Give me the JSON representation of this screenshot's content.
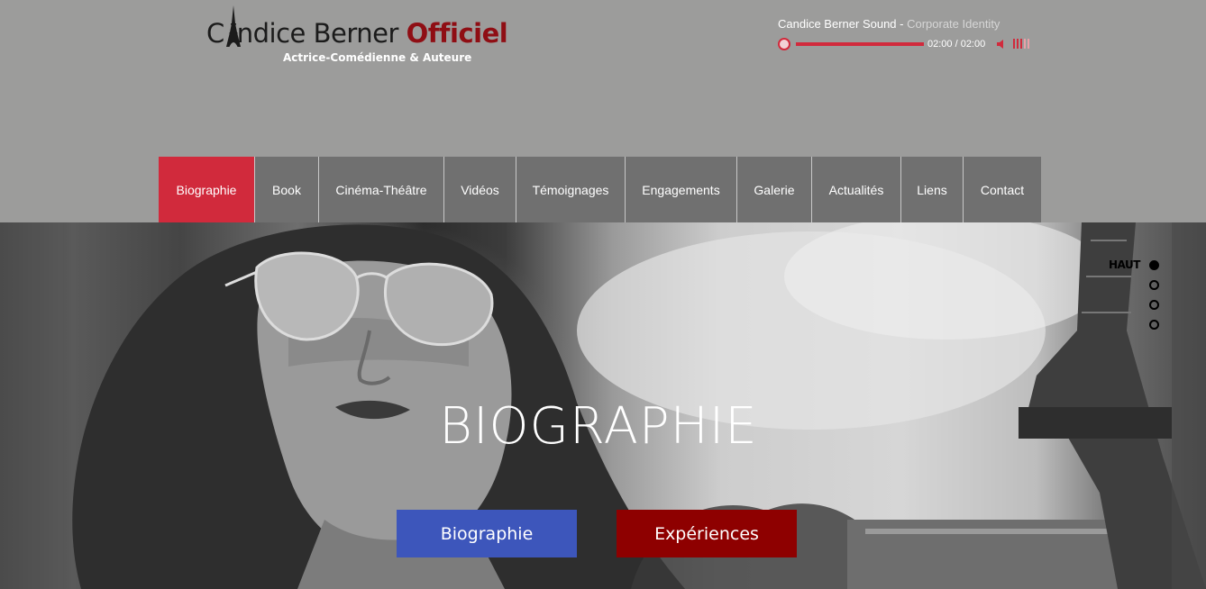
{
  "header": {
    "logo": {
      "first": "C",
      "name": "ndice Berner",
      "suffix": "Officiel",
      "subtitle": "Actrice-Comédienne & Auteure"
    }
  },
  "player": {
    "artist": "Candice Berner Sound",
    "separator": " - ",
    "track": "Corporate Identity",
    "time": "02:00 / 02:00",
    "progress_percent": 100,
    "icons": {
      "play": "play-circle-icon",
      "volume": "speaker-icon"
    }
  },
  "nav": {
    "items": [
      {
        "label": "Biographie",
        "active": true
      },
      {
        "label": "Book"
      },
      {
        "label": "Cinéma-Théâtre"
      },
      {
        "label": "Vidéos"
      },
      {
        "label": "Témoignages"
      },
      {
        "label": "Engagements"
      },
      {
        "label": "Galerie"
      },
      {
        "label": "Actualités"
      },
      {
        "label": "Liens"
      },
      {
        "label": "Contact"
      }
    ]
  },
  "hero": {
    "title": "BIOGRAPHIE",
    "buttons": {
      "biographie": "Biographie",
      "experiences": "Expériences"
    }
  },
  "anchors": {
    "label": "HAUT",
    "count": 4,
    "active_index": 0
  },
  "colors": {
    "accent": "#d12a3c",
    "nav_bg": "#707070",
    "page_bg": "#9c9c9b",
    "button_blue": "#3d56bb",
    "button_red": "#8e0000"
  }
}
